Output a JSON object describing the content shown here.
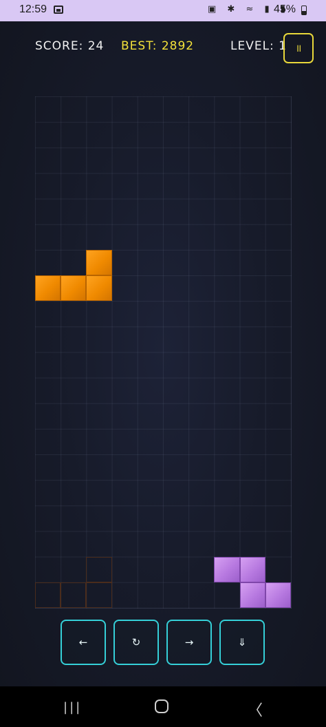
{
  "status_bar": {
    "time": "12:59",
    "gallery_icon": "image-icon",
    "icons": "▣ ✱ ≈ ▮ ▮",
    "battery": "45%"
  },
  "hud": {
    "score": "SCORE: 24",
    "best": "BEST: 2892",
    "level": "LEVEL: 1",
    "pause_symbol": "॥"
  },
  "board": {
    "columns": 10,
    "rows": 20,
    "active_piece": {
      "color": "#f08a00",
      "cells": [
        [
          2,
          6
        ],
        [
          0,
          7
        ],
        [
          1,
          7
        ],
        [
          2,
          7
        ]
      ]
    },
    "locked_pieces": [
      {
        "color": "#b779e0",
        "cells": [
          [
            7,
            18
          ],
          [
            8,
            18
          ],
          [
            8,
            19
          ],
          [
            9,
            19
          ]
        ]
      }
    ],
    "ghost_piece": {
      "color": "#4a2c1c",
      "cells": [
        [
          2,
          18
        ],
        [
          0,
          19
        ],
        [
          1,
          19
        ],
        [
          2,
          19
        ]
      ]
    }
  },
  "controls": {
    "left": "←",
    "rotate": "↻",
    "right": "→",
    "drop": "⇓"
  },
  "nav": {
    "recents": "|||",
    "back": "〈"
  }
}
